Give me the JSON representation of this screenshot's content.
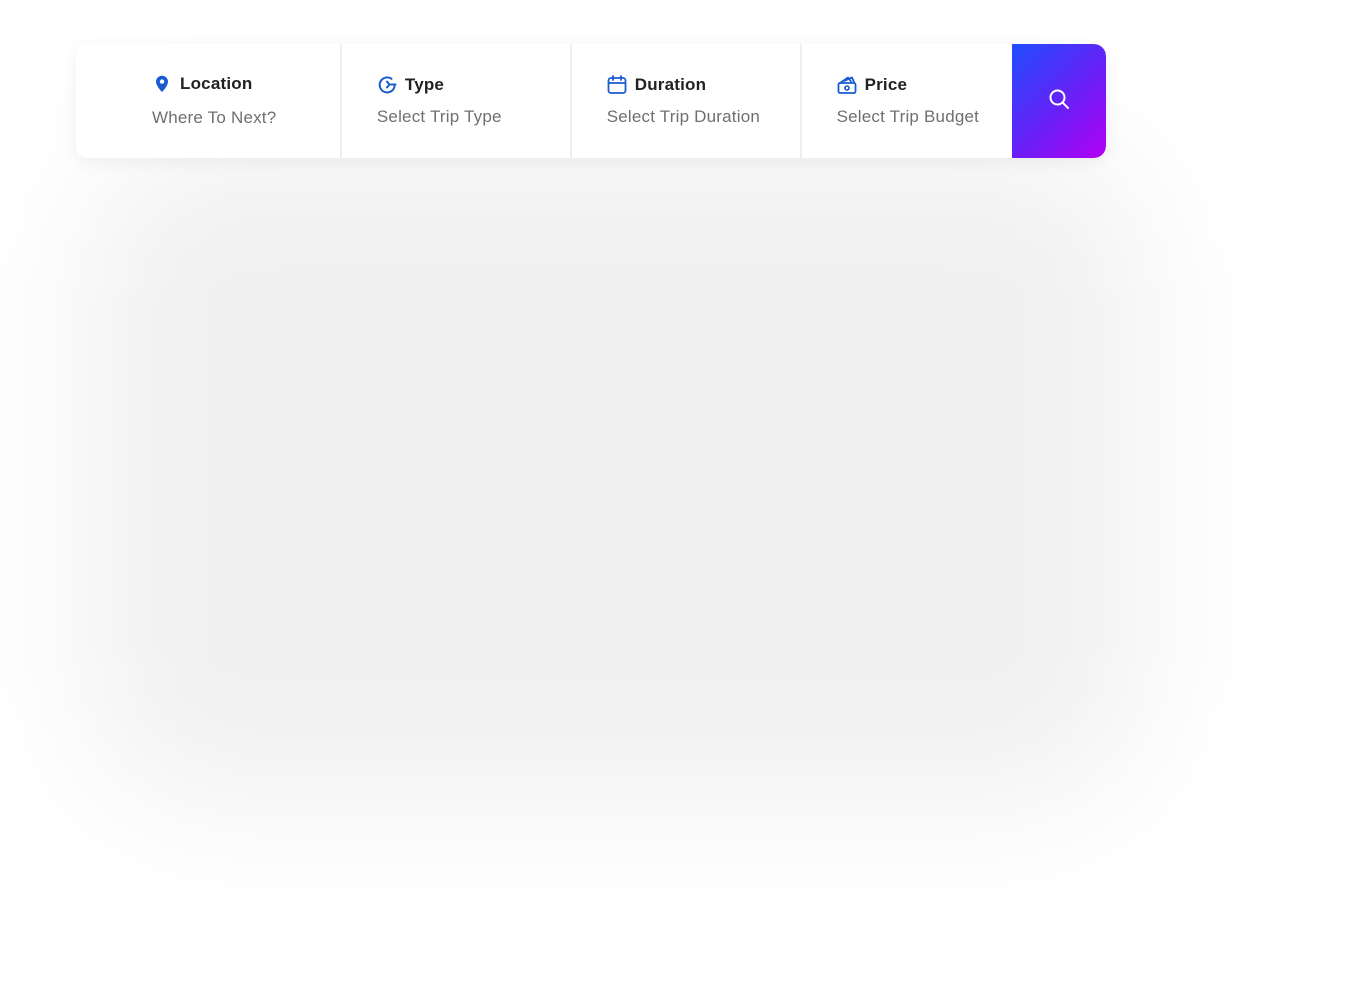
{
  "search_bar": {
    "location": {
      "label": "Location",
      "placeholder": "Where To Next?",
      "icon": "map-pin-icon"
    },
    "type": {
      "label": "Type",
      "placeholder": "Select Trip Type",
      "icon": "trip-type-icon"
    },
    "duration": {
      "label": "Duration",
      "placeholder": "Select Trip Duration",
      "icon": "calendar-icon"
    },
    "price": {
      "label": "Price",
      "placeholder": "Select Trip Budget",
      "icon": "wallet-icon"
    },
    "search_button": {
      "icon": "search-icon"
    }
  },
  "colors": {
    "icon_accent": "#1a5ccf",
    "gradient_start": "#1f4dfd",
    "gradient_end": "#b300f2",
    "label_text": "#222222",
    "placeholder_text": "#6f6f6f"
  }
}
